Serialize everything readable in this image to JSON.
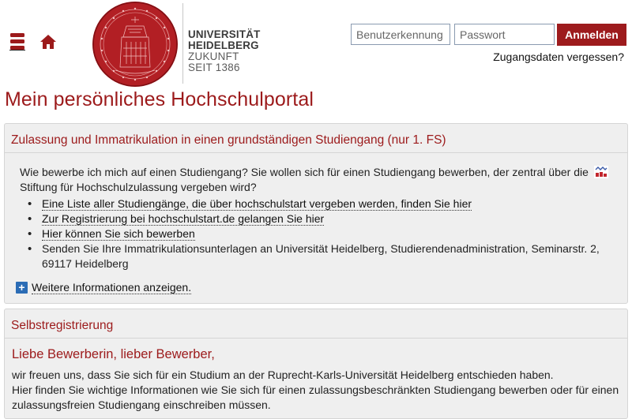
{
  "header": {
    "menu_icon": "menu-icon",
    "home_icon": "home-icon",
    "logo": {
      "line1": "UNIVERSITÄT",
      "line2": "HEIDELBERG",
      "line3": "ZUKUNFT",
      "line4": "SEIT 1386"
    },
    "login": {
      "user_placeholder": "Benutzerkennung",
      "pass_placeholder": "Passwort",
      "button_label": "Anmelden",
      "forgot_label": "Zugangsdaten vergessen?"
    }
  },
  "page": {
    "title": "Mein persönliches Hochschulportal"
  },
  "admission": {
    "title": "Zulassung und Immatrikulation in einen grundständigen Studiengang (nur 1. FS)",
    "intro": "Wie bewerbe ich mich auf einen Studiengang? Sie wollen sich für einen Studiengang bewerben, der zentral über die Stiftung für Hochschulzulassung vergeben wird?",
    "items": [
      "Eine Liste aller Studiengänge, die über hochschulstart vergeben werden, finden Sie hier",
      "Zur Registrierung bei hochschulstart.de gelangen Sie hier",
      "Hier können Sie sich bewerben",
      "Senden Sie Ihre Immatrikulationsunterlagen an Universität Heidelberg, Studierendenadministration, Seminarstr. 2, 69117 Heidelberg"
    ],
    "more_label": "Weitere Informationen anzeigen.",
    "more_icon": "plus-icon"
  },
  "selfreg": {
    "title": "Selbstregistrierung",
    "greeting": "Liebe Bewerberin, lieber Bewerber,",
    "text_line1": "wir freuen uns, dass Sie sich für ein Studium an der Ruprecht-Karls-Universität Heidelberg entschieden haben.",
    "text_line2": "Hier finden Sie wichtige Informationen wie Sie sich für einen zulassungsbeschränkten Studiengang bewerben oder für einen zulassungsfreien Studiengang einschreiben müssen."
  },
  "colors": {
    "brand_red": "#9c1a1b",
    "button_red": "#9d1b1d",
    "panel_bg": "#efefef",
    "plus_blue": "#2b6cb5"
  }
}
